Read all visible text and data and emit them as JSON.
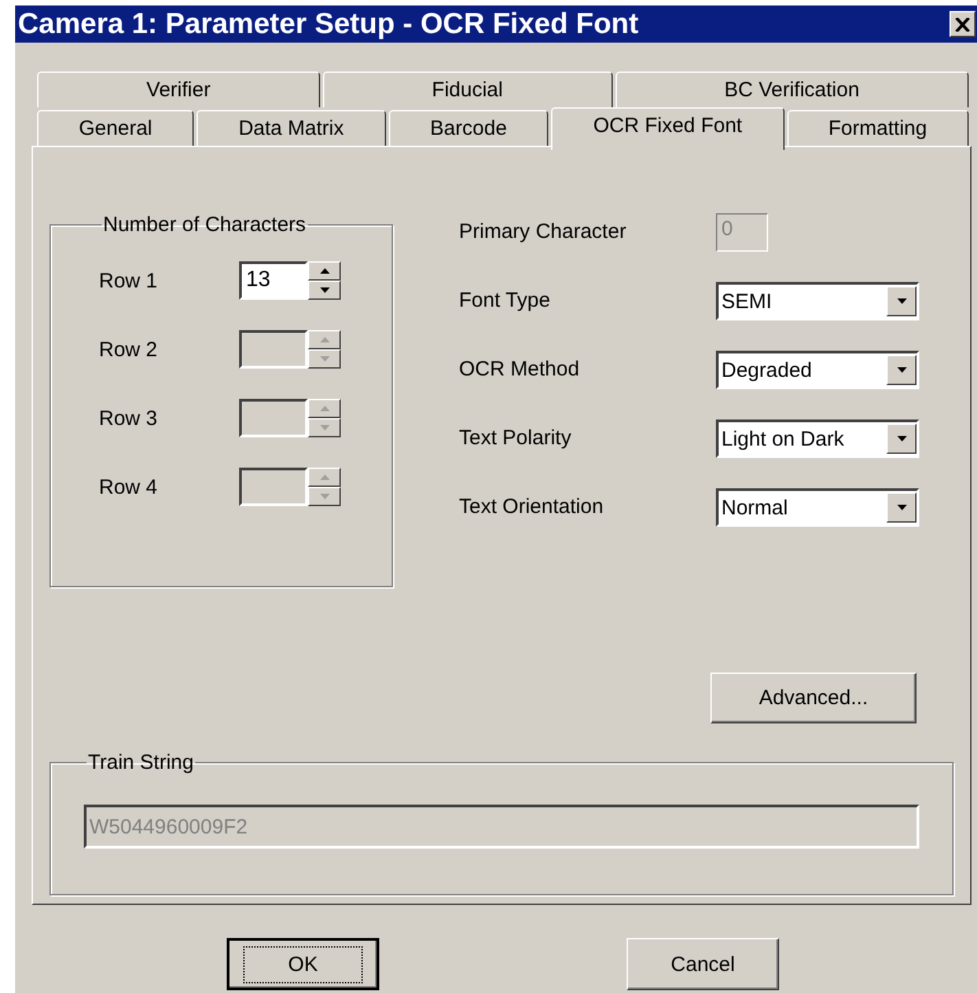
{
  "window": {
    "title": "Camera 1: Parameter Setup - OCR Fixed Font"
  },
  "tab_rows": [
    [
      {
        "label": "Verifier",
        "selected": false
      },
      {
        "label": "Fiducial",
        "selected": false
      },
      {
        "label": "BC Verification",
        "selected": false
      }
    ],
    [
      {
        "label": "General",
        "selected": false
      },
      {
        "label": "Data Matrix",
        "selected": false
      },
      {
        "label": "Barcode",
        "selected": false
      },
      {
        "label": "OCR Fixed Font",
        "selected": true
      },
      {
        "label": "Formatting",
        "selected": false
      }
    ]
  ],
  "characters_group": {
    "title": "Number of Characters",
    "rows": [
      {
        "label": "Row 1",
        "value": "13",
        "disabled": false
      },
      {
        "label": "Row 2",
        "disabled": true
      },
      {
        "label": "Row 3",
        "disabled": true
      },
      {
        "label": "Row 4",
        "disabled": true
      }
    ]
  },
  "primary_character": {
    "label": "Primary Character",
    "value": "0",
    "disabled": true
  },
  "dropdowns": [
    {
      "label": "Font Type",
      "value": "SEMI"
    },
    {
      "label": "OCR Method",
      "value": "Degraded"
    },
    {
      "label": "Text Polarity",
      "value": "Light on Dark"
    },
    {
      "label": "Text Orientation",
      "value": "Normal"
    }
  ],
  "advanced_button": "Advanced...",
  "train_group": {
    "title": "Train String",
    "value": "W5044960009F2",
    "disabled": true
  },
  "buttons": [
    {
      "label": "OK",
      "default": true
    },
    {
      "label": "Cancel",
      "default": false
    }
  ]
}
